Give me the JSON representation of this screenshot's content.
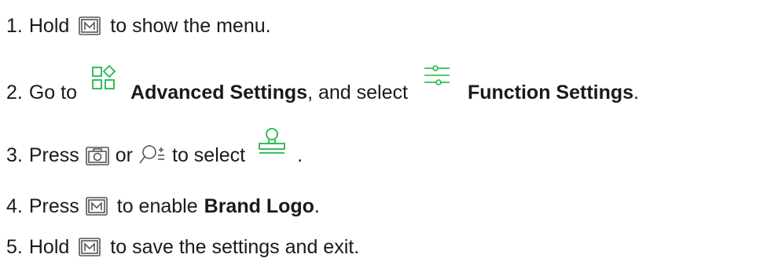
{
  "colors": {
    "text": "#1a1a1a",
    "accent_icon": "#1fb84a",
    "key_icon": "#555555"
  },
  "icons": {
    "m_key": "m-key-icon",
    "advanced_settings": "advanced-settings-icon",
    "function_settings": "function-settings-icon",
    "camera_key": "camera-key-icon",
    "zoom_key": "zoom-key-icon",
    "brand_logo": "brand-logo-icon"
  },
  "steps": [
    {
      "num": "1.",
      "verb": "Hold",
      "rest": "to show the menu."
    },
    {
      "num": "2.",
      "verb": "Go to",
      "target1": "Advanced Settings",
      "middle": ", and select",
      "target2": "Function Settings",
      "end": "."
    },
    {
      "num": "3.",
      "verb": "Press",
      "or": "or",
      "rest": "to select",
      "end": "."
    },
    {
      "num": "4.",
      "verb": "Press",
      "rest": "to enable",
      "target": "Brand Logo",
      "end": "."
    },
    {
      "num": "5.",
      "verb": "Hold",
      "rest": "to save the settings and exit."
    }
  ]
}
